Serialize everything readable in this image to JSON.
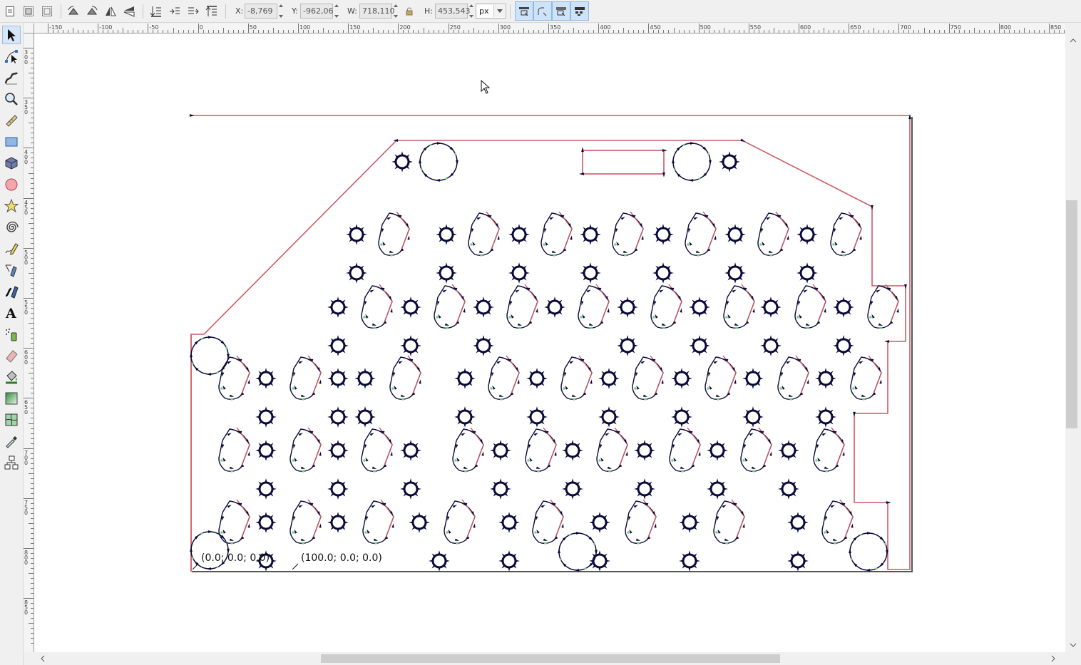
{
  "toolbar": {
    "labels": {
      "x": "X:",
      "y": "Y:",
      "w": "W:",
      "h": "H:"
    },
    "values": {
      "x": "-8,769",
      "y": "-962,06",
      "w": "718,110",
      "h": "453,543"
    },
    "unit": "px"
  },
  "ruler": {
    "h_labels": [
      "-150",
      "-100",
      "-50",
      "0",
      "50",
      "100",
      "150",
      "200",
      "250",
      "300",
      "350",
      "400",
      "450",
      "500",
      "550",
      "600",
      "650",
      "700",
      "750",
      "800",
      "850"
    ],
    "v_labels": [
      "-300",
      "-350",
      "-400",
      "-450",
      "-500",
      "-550",
      "-600",
      "-650",
      "-700",
      "-750",
      "-800",
      "-850"
    ]
  },
  "canvas": {
    "coord_label_origin": "(0.0; 0.0; 0.0)",
    "coord_label_x": "(100.0; 0.0; 0.0)"
  },
  "colors": {
    "outline": "#cc5a66",
    "node": "#0a0a3a",
    "handle": "#7fd07f",
    "accent": "#cfe3f8"
  }
}
